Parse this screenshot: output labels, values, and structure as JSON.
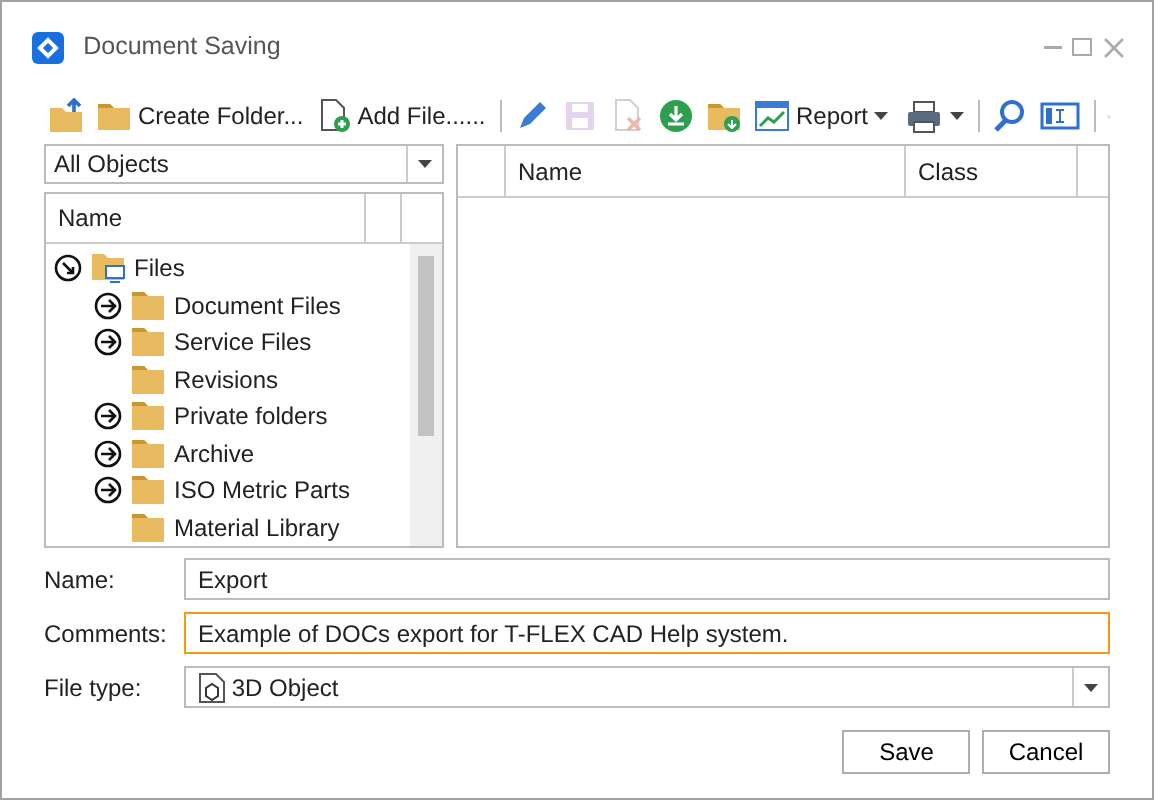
{
  "window": {
    "title": "Document Saving"
  },
  "toolbar": [
    {
      "kind": "folder-up",
      "disabled": false
    },
    {
      "kind": "folder",
      "label": "Create Folder...",
      "disabled": false
    },
    {
      "kind": "add-file",
      "label": "Add File......",
      "disabled": false
    },
    {
      "kind": "sep"
    },
    {
      "kind": "pencil",
      "disabled": false
    },
    {
      "kind": "save",
      "disabled": true
    },
    {
      "kind": "delete",
      "disabled": true
    },
    {
      "kind": "download",
      "disabled": false
    },
    {
      "kind": "folder-download",
      "disabled": false
    },
    {
      "kind": "report",
      "label": "Report",
      "dropdown": true,
      "disabled": false
    },
    {
      "kind": "spacer"
    },
    {
      "kind": "print",
      "dropdown": true,
      "disabled": false
    },
    {
      "kind": "sep"
    },
    {
      "kind": "search",
      "disabled": false
    },
    {
      "kind": "panel",
      "disabled": false
    },
    {
      "kind": "sep"
    }
  ],
  "filter": {
    "value": "All Objects"
  },
  "tree": {
    "columns": [
      "Name"
    ],
    "items": [
      {
        "label": "Files",
        "kind": "root",
        "expandable": true,
        "expanded": true,
        "children": [
          {
            "label": "Document Files",
            "expandable": true,
            "expanded": false
          },
          {
            "label": "Service Files",
            "expandable": true,
            "expanded": false
          },
          {
            "label": "Revisions",
            "expandable": false
          },
          {
            "label": "Private folders",
            "expandable": true,
            "expanded": false
          },
          {
            "label": "Archive",
            "expandable": true,
            "expanded": false
          },
          {
            "label": "ISO Metric Parts",
            "expandable": true,
            "expanded": false
          },
          {
            "label": "Material Library",
            "expandable": false
          }
        ]
      }
    ]
  },
  "table": {
    "columns": [
      "Name",
      "Class"
    ]
  },
  "form": [
    {
      "label": "Name:",
      "value": "Export",
      "focused": false,
      "kind": "text"
    },
    {
      "label": "Comments:",
      "value": "Example of DOCs export for T-FLEX CAD Help system.",
      "focused": true,
      "kind": "text"
    },
    {
      "label": "File type:",
      "value": "3D Object",
      "focused": false,
      "kind": "select"
    }
  ],
  "buttons": [
    "Save",
    "Cancel"
  ]
}
